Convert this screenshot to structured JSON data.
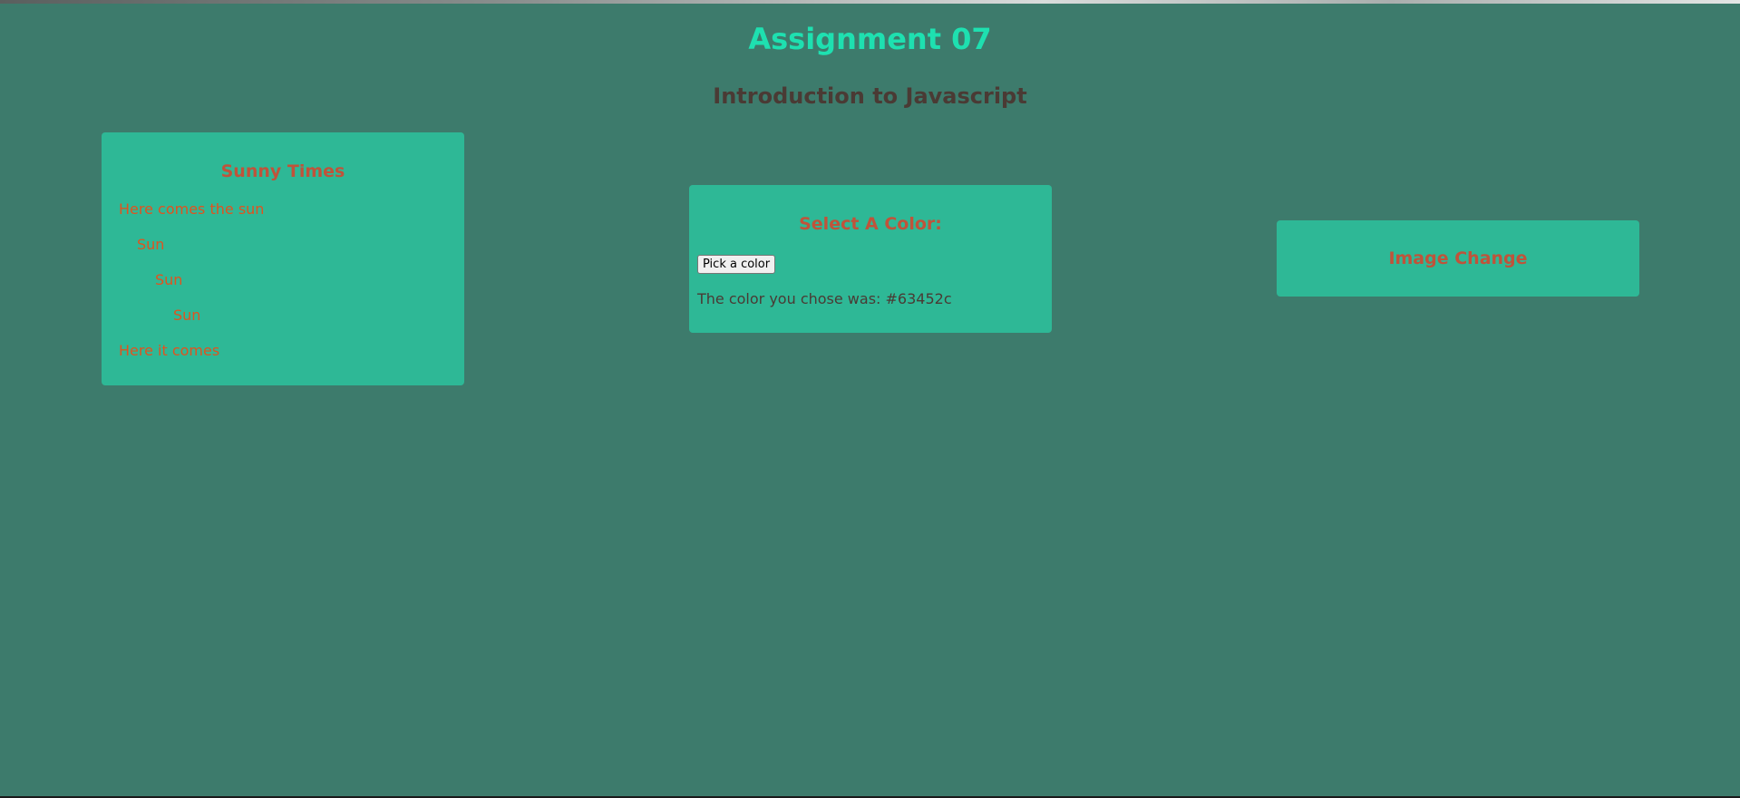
{
  "header": {
    "title": "Assignment 07",
    "subtitle": "Introduction to Javascript"
  },
  "sunny_card": {
    "heading": "Sunny Times",
    "lines": [
      "Here comes the sun",
      "Sun",
      "Sun",
      "Sun",
      "Here it comes"
    ]
  },
  "color_card": {
    "heading": "Select A Color:",
    "button_label": "Pick a color",
    "result_text": "The color you chose was: #63452c"
  },
  "image_card": {
    "heading": "Image Change"
  },
  "colors": {
    "background": "#3d7b6c",
    "card": "#2eb896",
    "title": "#1ee0b0",
    "subtitle": "#4a3a34",
    "card_heading": "#c0533a",
    "sun_text": "#e0531f"
  }
}
